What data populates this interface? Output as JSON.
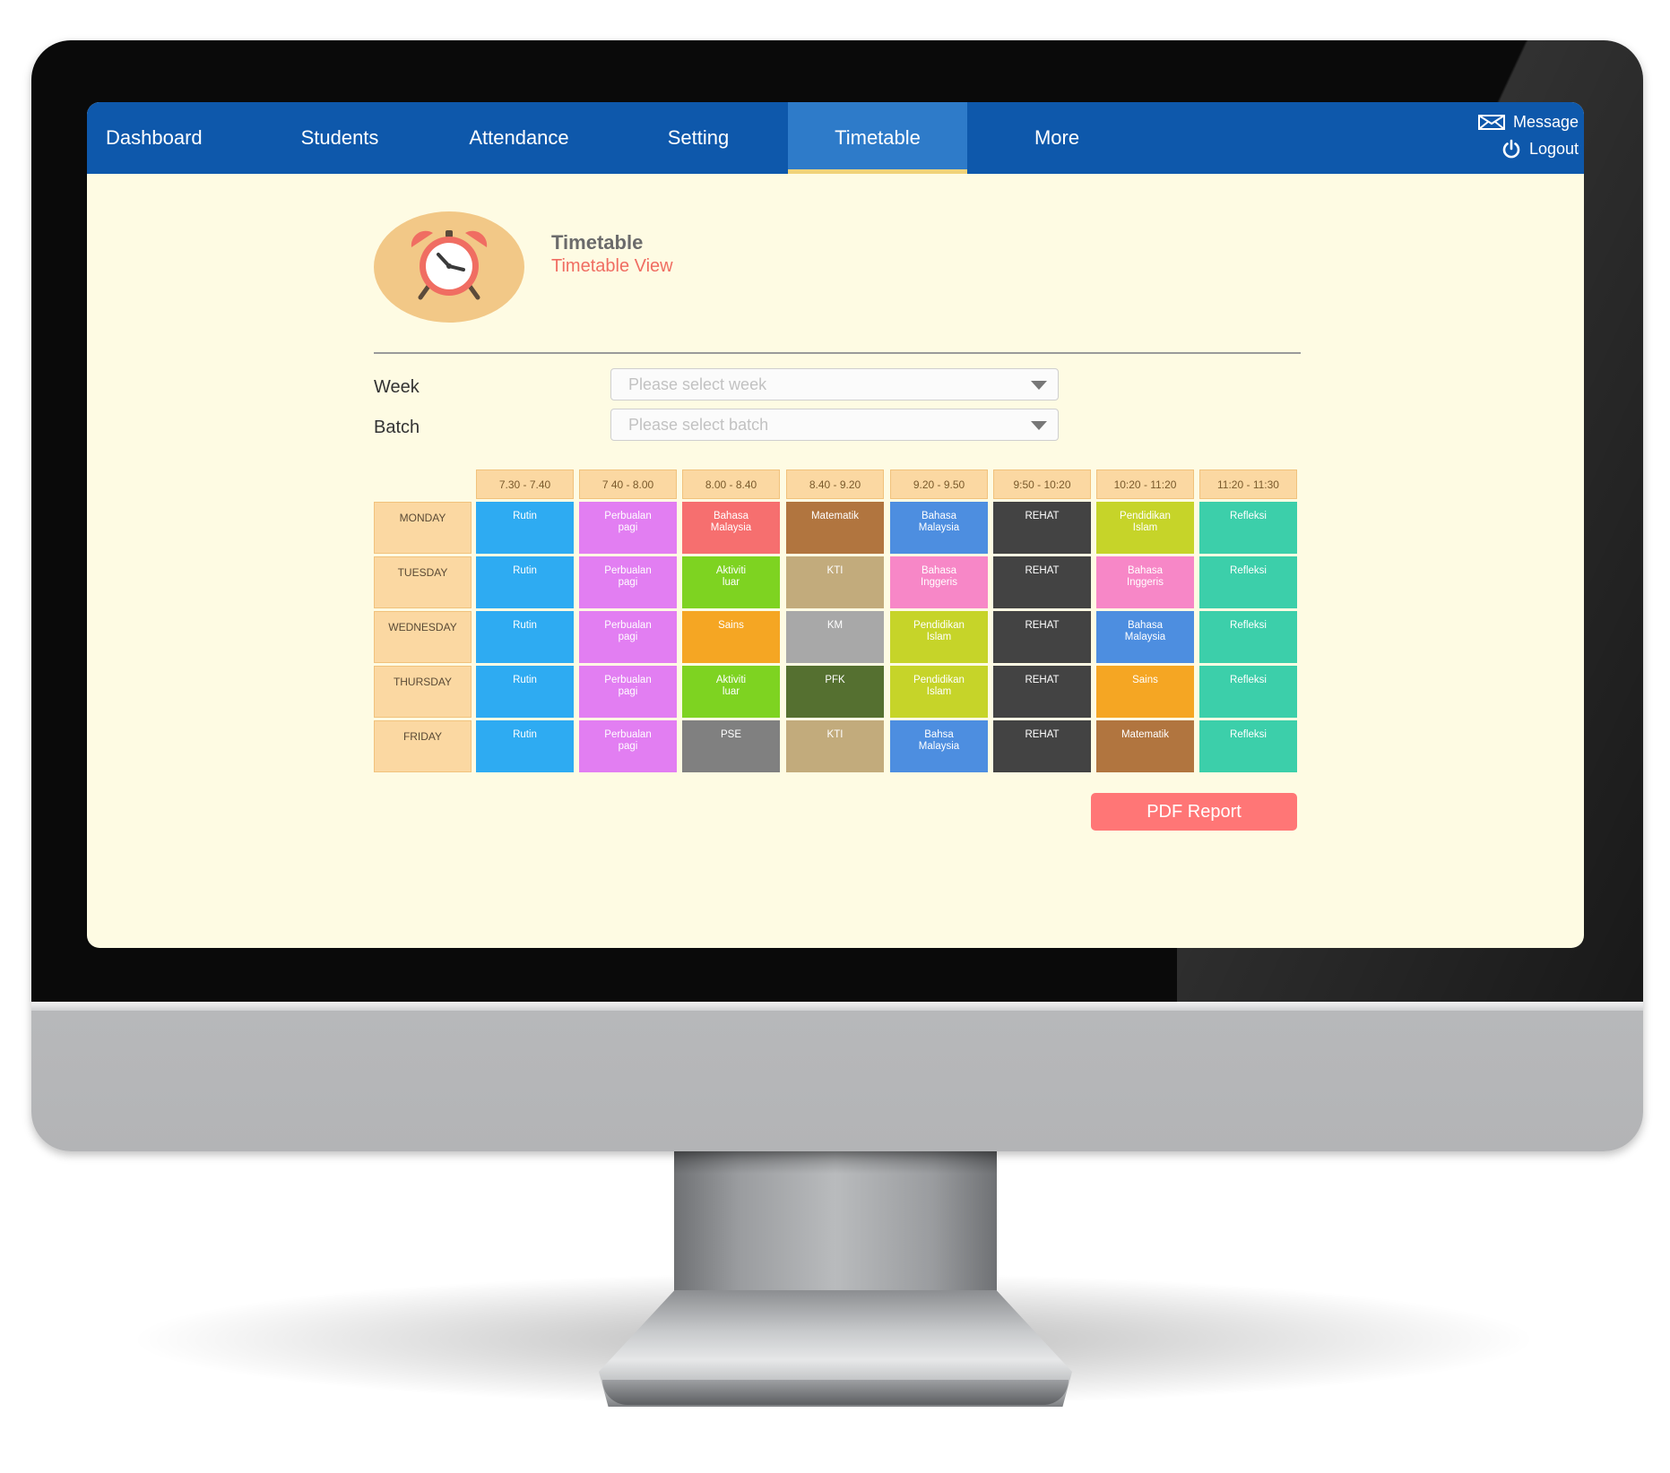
{
  "nav": {
    "tabs": [
      {
        "label": "Dashboard",
        "active": false
      },
      {
        "label": "Students",
        "active": false
      },
      {
        "label": "Attendance",
        "active": false
      },
      {
        "label": "Setting",
        "active": false
      },
      {
        "label": "Timetable",
        "active": true
      },
      {
        "label": "More",
        "active": false
      }
    ],
    "message_label": "Message",
    "logout_label": "Logout",
    "icons": {
      "message": "envelope-icon",
      "logout": "power-icon"
    }
  },
  "header": {
    "title": "Timetable",
    "subtitle": "Timetable View",
    "icon": "alarm-clock-icon"
  },
  "filters": {
    "week": {
      "label": "Week",
      "placeholder": "Please select week"
    },
    "batch": {
      "label": "Batch",
      "placeholder": "Please select batch"
    }
  },
  "timetable": {
    "time_slots": [
      "7.30 - 7.40",
      "7 40 - 8.00",
      "8.00 - 8.40",
      "8.40 - 9.20",
      "9.20 - 9.50",
      "9:50 - 10:20",
      "10:20 - 11:20",
      "11:20 - 11:30"
    ],
    "days": [
      {
        "day": "MONDAY",
        "cells": [
          {
            "lines": [
              "Rutin"
            ],
            "color": "#2eabf2"
          },
          {
            "lines": [
              "Perbualan",
              "pagi"
            ],
            "color": "#e27ef2"
          },
          {
            "lines": [
              "Bahasa",
              "Malaysia"
            ],
            "color": "#f66f6f"
          },
          {
            "lines": [
              "Matematik"
            ],
            "color": "#b1753f"
          },
          {
            "lines": [
              "Bahasa",
              "Malaysia"
            ],
            "color": "#4d8ee0"
          },
          {
            "lines": [
              "REHAT"
            ],
            "color": "#434343"
          },
          {
            "lines": [
              "Pendidikan",
              "Islam"
            ],
            "color": "#c6d429"
          },
          {
            "lines": [
              "Refleksi"
            ],
            "color": "#3ccfaa"
          }
        ]
      },
      {
        "day": "TUESDAY",
        "cells": [
          {
            "lines": [
              "Rutin"
            ],
            "color": "#2eabf2"
          },
          {
            "lines": [
              "Perbualan",
              "pagi"
            ],
            "color": "#e27ef2"
          },
          {
            "lines": [
              "Aktiviti",
              "luar"
            ],
            "color": "#7ed321"
          },
          {
            "lines": [
              "KTI"
            ],
            "color": "#c2ab7c"
          },
          {
            "lines": [
              "Bahasa",
              "Inggeris"
            ],
            "color": "#f787c7"
          },
          {
            "lines": [
              "REHAT"
            ],
            "color": "#434343"
          },
          {
            "lines": [
              "Bahasa",
              "Inggeris"
            ],
            "color": "#f787c7"
          },
          {
            "lines": [
              "Refleksi"
            ],
            "color": "#3ccfaa"
          }
        ]
      },
      {
        "day": "WEDNESDAY",
        "cells": [
          {
            "lines": [
              "Rutin"
            ],
            "color": "#2eabf2"
          },
          {
            "lines": [
              "Perbualan",
              "pagi"
            ],
            "color": "#e27ef2"
          },
          {
            "lines": [
              "Sains"
            ],
            "color": "#f5a623"
          },
          {
            "lines": [
              "KM"
            ],
            "color": "#a8a8a8"
          },
          {
            "lines": [
              "Pendidikan",
              "Islam"
            ],
            "color": "#c6d429"
          },
          {
            "lines": [
              "REHAT"
            ],
            "color": "#434343"
          },
          {
            "lines": [
              "Bahasa",
              "Malaysia"
            ],
            "color": "#4d8ee0"
          },
          {
            "lines": [
              "Refleksi"
            ],
            "color": "#3ccfaa"
          }
        ]
      },
      {
        "day": "THURSDAY",
        "cells": [
          {
            "lines": [
              "Rutin"
            ],
            "color": "#2eabf2"
          },
          {
            "lines": [
              "Perbualan",
              "pagi"
            ],
            "color": "#e27ef2"
          },
          {
            "lines": [
              "Aktiviti",
              "luar"
            ],
            "color": "#7ed321"
          },
          {
            "lines": [
              "PFK"
            ],
            "color": "#557030"
          },
          {
            "lines": [
              "Pendidikan",
              "Islam"
            ],
            "color": "#c6d429"
          },
          {
            "lines": [
              "REHAT"
            ],
            "color": "#434343"
          },
          {
            "lines": [
              "Sains"
            ],
            "color": "#f5a623"
          },
          {
            "lines": [
              "Refleksi"
            ],
            "color": "#3ccfaa"
          }
        ]
      },
      {
        "day": "FRIDAY",
        "cells": [
          {
            "lines": [
              "Rutin"
            ],
            "color": "#2eabf2"
          },
          {
            "lines": [
              "Perbualan",
              "pagi"
            ],
            "color": "#e27ef2"
          },
          {
            "lines": [
              "PSE"
            ],
            "color": "#808080"
          },
          {
            "lines": [
              "KTI"
            ],
            "color": "#c2ab7c"
          },
          {
            "lines": [
              "Bahsa",
              "Malaysia"
            ],
            "color": "#4d8ee0"
          },
          {
            "lines": [
              "REHAT"
            ],
            "color": "#434343"
          },
          {
            "lines": [
              "Matematik"
            ],
            "color": "#b1753f"
          },
          {
            "lines": [
              "Refleksi"
            ],
            "color": "#3ccfaa"
          }
        ]
      }
    ]
  },
  "actions": {
    "pdf_label": "PDF Report"
  },
  "colors": {
    "nav": "#0e58ab",
    "nav_active": "#2e7bc9",
    "screen_bg": "#fefbe3",
    "accent": "#f06d62",
    "pdf_button": "#ff7676",
    "slot_bg": "#fbd8a2"
  }
}
